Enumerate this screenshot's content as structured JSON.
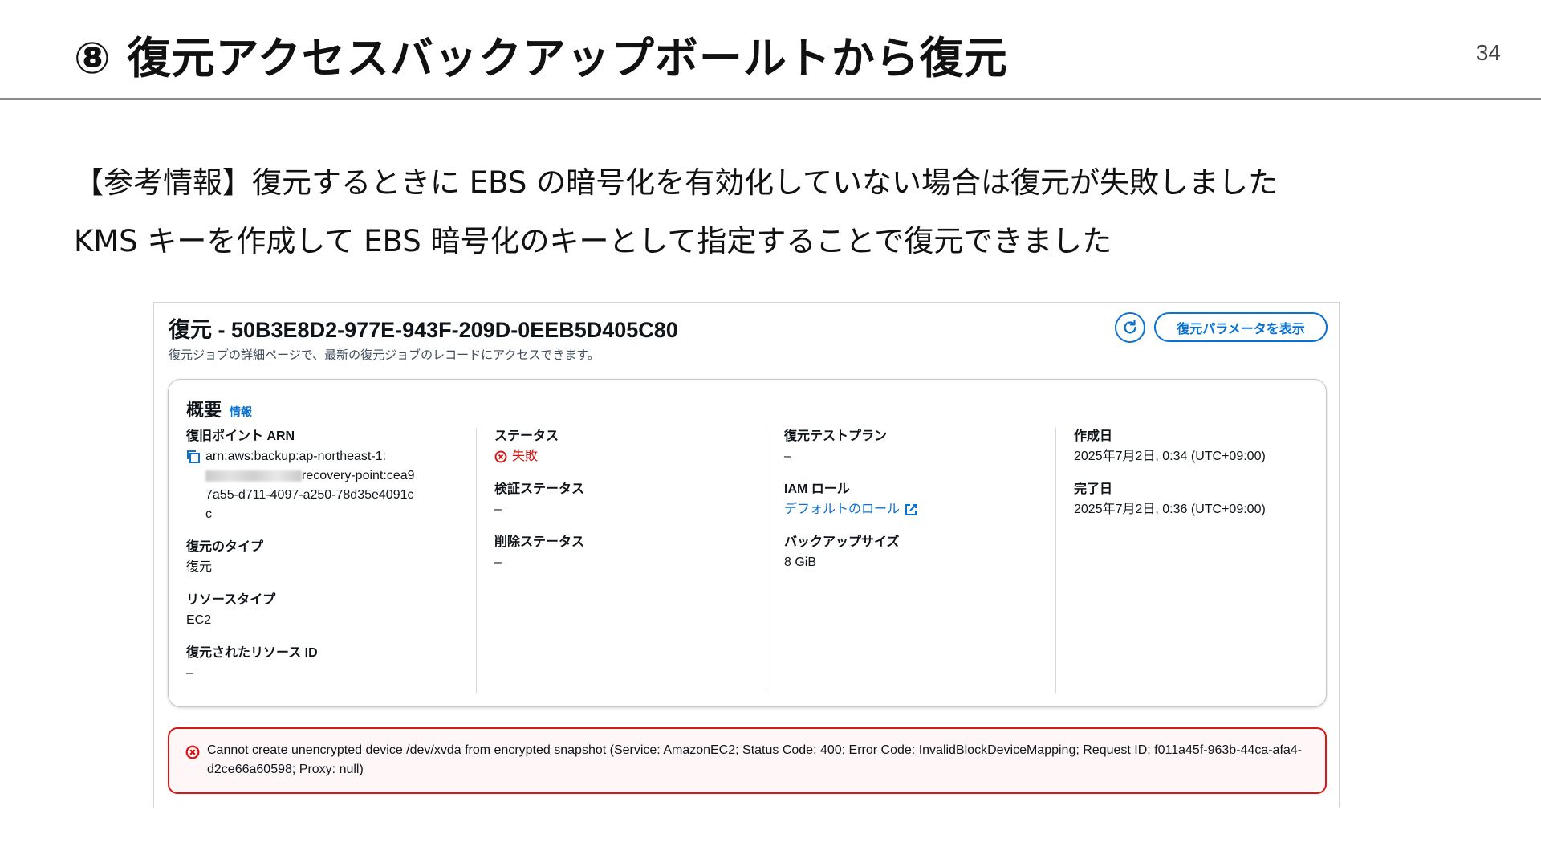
{
  "slide": {
    "title": "⑧ 復元アクセスバックアップボールトから復元",
    "page_number": "34",
    "note_line1": "【参考情報】復元するときに EBS の暗号化を有効化していない場合は復元が失敗しました",
    "note_line2": "KMS キーを作成して EBS 暗号化のキーとして指定することで復元できました"
  },
  "job": {
    "title": "復元 - 50B3E8D2-977E-943F-209D-0EEB5D405C80",
    "description": "復元ジョブの詳細ページで、最新の復元ジョブのレコードにアクセスできます。",
    "refresh_icon": "refresh-icon",
    "params_button": "復元パラメータを表示"
  },
  "summary": {
    "title": "概要",
    "info_link": "情報",
    "recovery_point_arn": {
      "label": "復旧ポイント ARN",
      "copy_icon": "copy-icon",
      "part1": "arn:aws:backup:ap-northeast-1:",
      "part2": "recovery-point:cea97a55-d711-4097-a250-78d35e4091cc"
    },
    "restore_type": {
      "label": "復元のタイプ",
      "value": "復元"
    },
    "resource_type": {
      "label": "リソースタイプ",
      "value": "EC2"
    },
    "restored_resource_id": {
      "label": "復元されたリソース ID",
      "value": "–"
    },
    "status": {
      "label": "ステータス",
      "value": "失敗",
      "color": "#d91515"
    },
    "validation_status": {
      "label": "検証ステータス",
      "value": "–"
    },
    "deletion_status": {
      "label": "削除ステータス",
      "value": "–"
    },
    "restore_test_plan": {
      "label": "復元テストプラン",
      "value": "–"
    },
    "iam_role": {
      "label": "IAM ロール",
      "value": "デフォルトのロール"
    },
    "backup_size": {
      "label": "バックアップサイズ",
      "value": "8 GiB"
    },
    "created": {
      "label": "作成日",
      "value": "2025年7月2日, 0:34 (UTC+09:00)"
    },
    "completed": {
      "label": "完了日",
      "value": "2025年7月2日, 0:36 (UTC+09:00)"
    }
  },
  "error": {
    "icon": "error-icon",
    "message": "Cannot create unencrypted device /dev/xvda from encrypted snapshot (Service: AmazonEC2; Status Code: 400; Error Code: InvalidBlockDeviceMapping; Request ID: f011a45f-963b-44ca-afa4-d2ce66a60598; Proxy: null)",
    "color": "#d91515"
  },
  "colors": {
    "link": "#0972d3",
    "error": "#d91515"
  }
}
